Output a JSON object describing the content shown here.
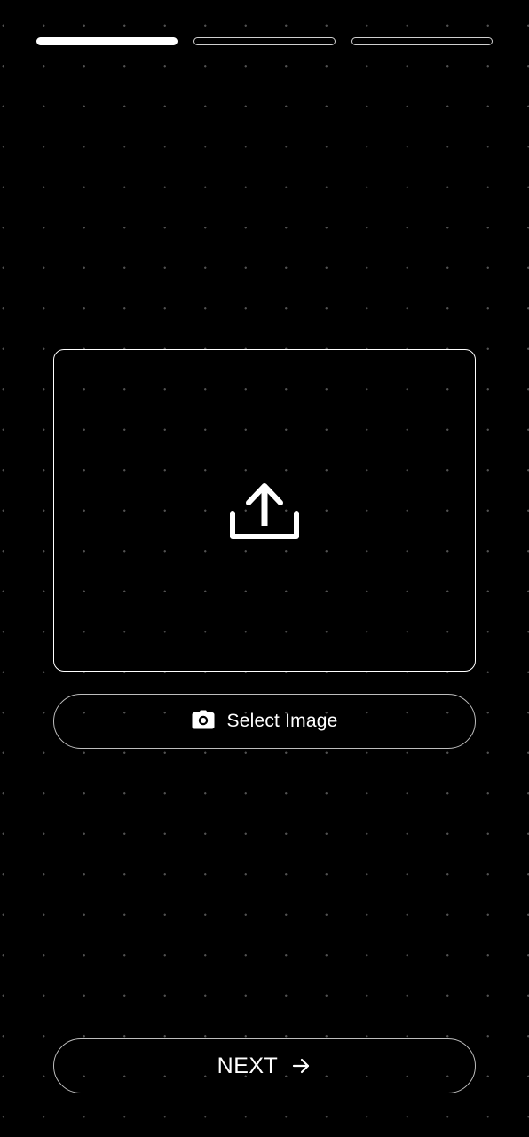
{
  "progress": {
    "total_steps": 3,
    "current_step": 1
  },
  "upload_area": {
    "icon": "upload-icon"
  },
  "select_image_button": {
    "icon": "camera-icon",
    "label": "Select Image"
  },
  "next_button": {
    "label": "NEXT",
    "icon": "arrow-right-icon"
  },
  "colors": {
    "background": "#000000",
    "foreground": "#ffffff",
    "outline": "#bdbdbd"
  }
}
